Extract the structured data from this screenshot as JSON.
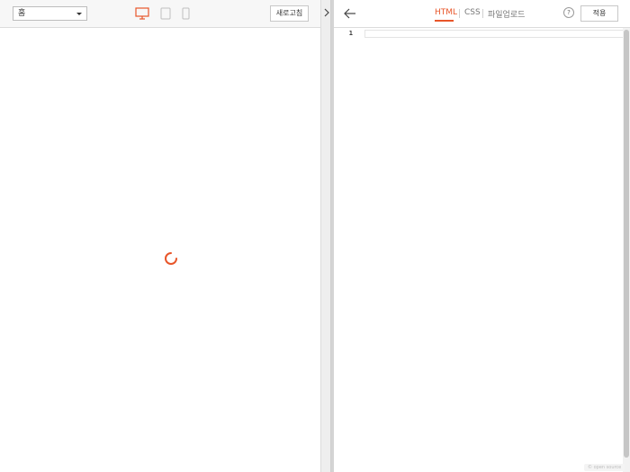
{
  "preview": {
    "page_select": {
      "selected": "홈"
    },
    "devices": [
      {
        "name": "desktop",
        "active": true
      },
      {
        "name": "tablet",
        "active": false
      },
      {
        "name": "mobile",
        "active": false
      }
    ],
    "refresh_label": "새로고침",
    "loading": true
  },
  "editor": {
    "tabs": [
      {
        "label": "HTML",
        "active": true
      },
      {
        "label": "CSS",
        "active": false
      },
      {
        "label": "파일업로드",
        "active": false
      }
    ],
    "help_label": "?",
    "apply_label": "적용",
    "lines": [
      {
        "number": "1",
        "content": ""
      }
    ],
    "footer_tag": "© open source"
  },
  "colors": {
    "accent": "#e8562a",
    "inactive_icon": "#bfbfbf"
  }
}
